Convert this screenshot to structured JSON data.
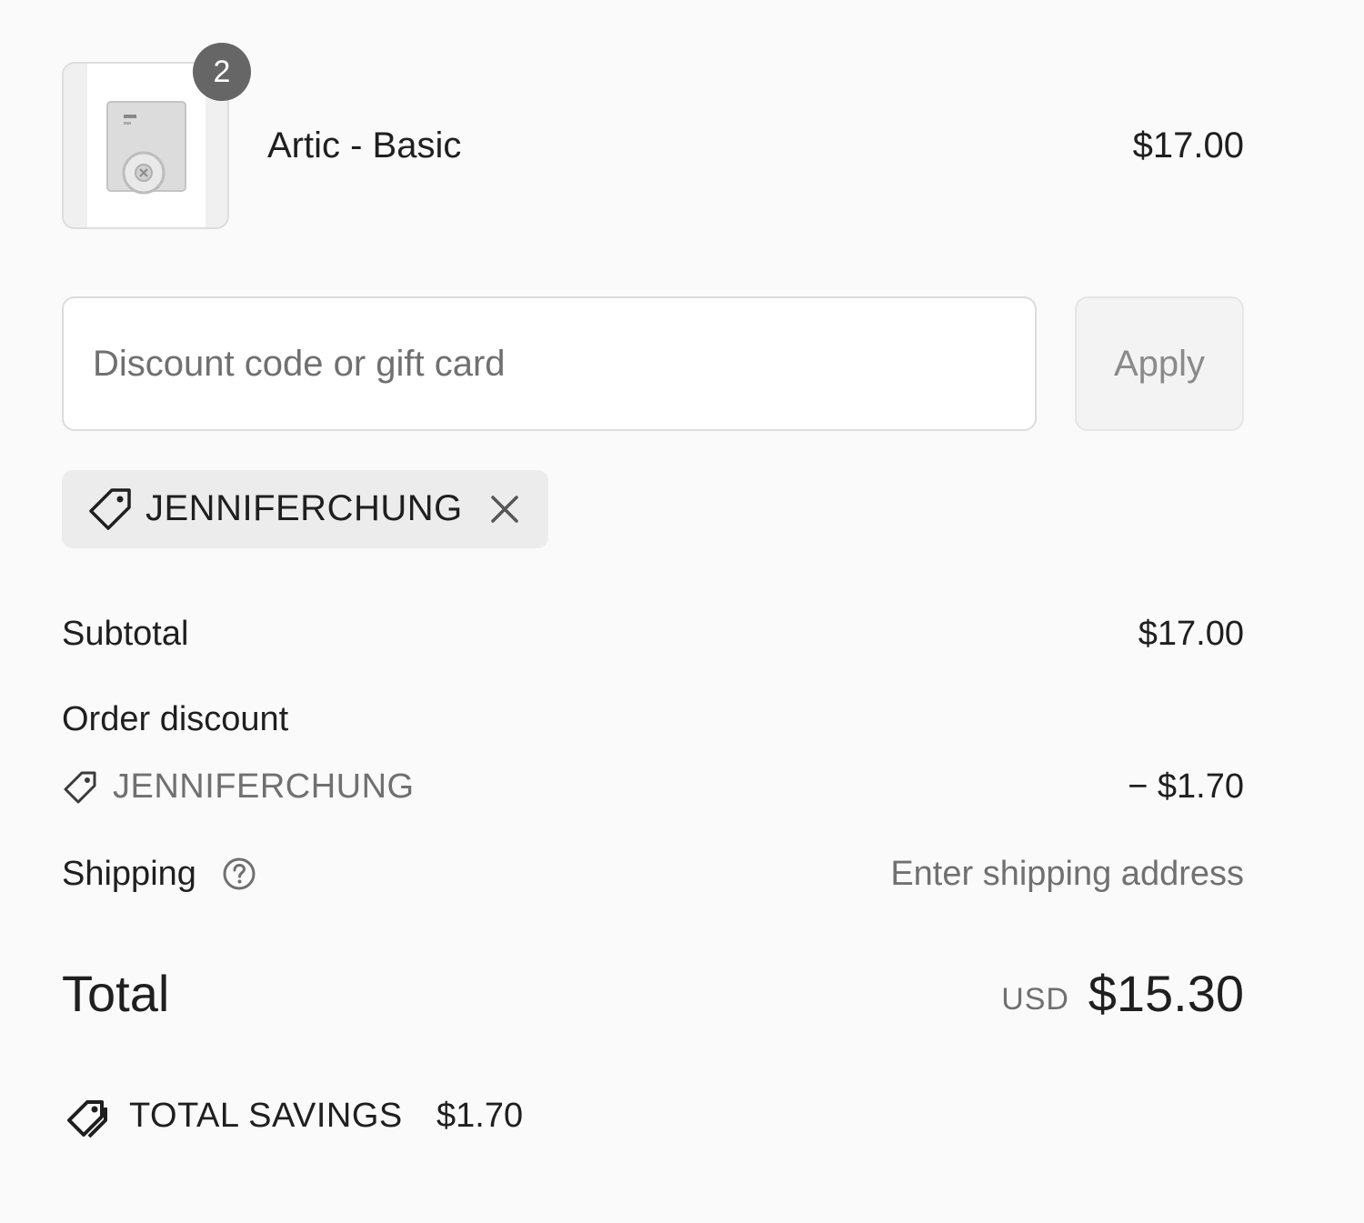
{
  "line_item": {
    "quantity": "2",
    "title": "Artic - Basic",
    "price": "$17.00",
    "thumbnail_icon": "product-box-icon"
  },
  "discount": {
    "placeholder": "Discount code or gift card",
    "value": "",
    "apply_label": "Apply",
    "applied_code": "JENNIFERCHUNG"
  },
  "summary": {
    "subtotal_label": "Subtotal",
    "subtotal_value": "$17.00",
    "order_discount_label": "Order discount",
    "order_discount_code": "JENNIFERCHUNG",
    "order_discount_value": "− $1.70",
    "shipping_label": "Shipping",
    "shipping_value": "Enter shipping address"
  },
  "total": {
    "label": "Total",
    "currency": "USD",
    "amount": "$15.30"
  },
  "savings": {
    "label": "TOTAL SAVINGS",
    "amount": "$1.70"
  },
  "colors": {
    "page_background": "#fafafa",
    "text_primary": "#1f1f1f",
    "text_muted": "#707070",
    "badge_background": "#666666",
    "chip_background": "#ececec"
  }
}
